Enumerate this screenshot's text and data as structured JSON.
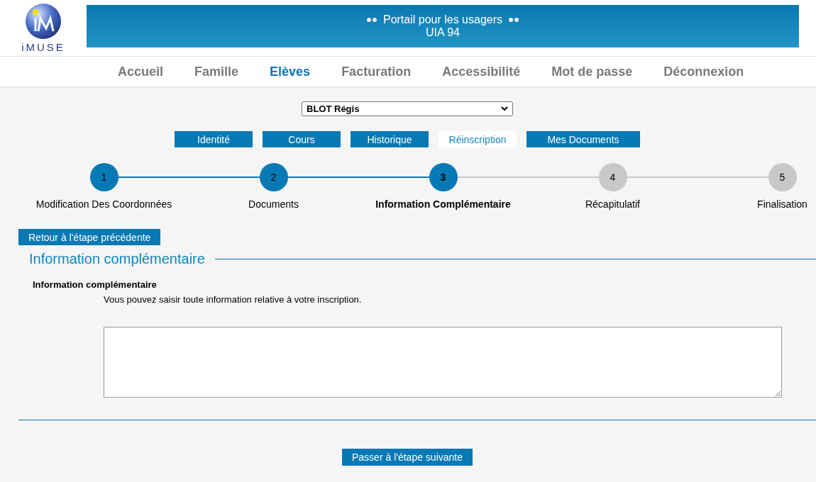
{
  "header": {
    "logo_text": "iMUSE",
    "title": "Portail pour les usagers",
    "subtitle": "UIA 94"
  },
  "nav": [
    {
      "label": "Accueil",
      "selected": false
    },
    {
      "label": "Famille",
      "selected": false
    },
    {
      "label": "Elèves",
      "selected": true
    },
    {
      "label": "Facturation",
      "selected": false
    },
    {
      "label": "Accessibilité",
      "selected": false
    },
    {
      "label": "Mot de passe",
      "selected": false
    },
    {
      "label": "Déconnexion",
      "selected": false
    }
  ],
  "student_select": {
    "value": "BLOT Régis"
  },
  "tabs": [
    {
      "label": "Identité",
      "selected": false
    },
    {
      "label": "Cours",
      "selected": false
    },
    {
      "label": "Historique",
      "selected": false
    },
    {
      "label": "Réinscription",
      "selected": true
    },
    {
      "label": "Mes Documents",
      "selected": false
    }
  ],
  "steps": [
    {
      "number": "1",
      "label": "Modification Des Coordonnées",
      "done": true,
      "selected": false
    },
    {
      "number": "2",
      "label": "Documents",
      "done": true,
      "selected": false
    },
    {
      "number": "3",
      "label": "Information Complémentaire",
      "done": true,
      "selected": true
    },
    {
      "number": "4",
      "label": "Récapitulatif",
      "done": false,
      "selected": false
    },
    {
      "number": "5",
      "label": "Finalisation",
      "done": false,
      "selected": false
    }
  ],
  "back_button": "Retour à l'étape précédente",
  "section": {
    "legend": "Information complémentaire",
    "field_label": "Information complémentaire",
    "help": "Vous pouvez saisir toute information relative à votre inscription."
  },
  "next_button": "Passer à l'étape suivante"
}
